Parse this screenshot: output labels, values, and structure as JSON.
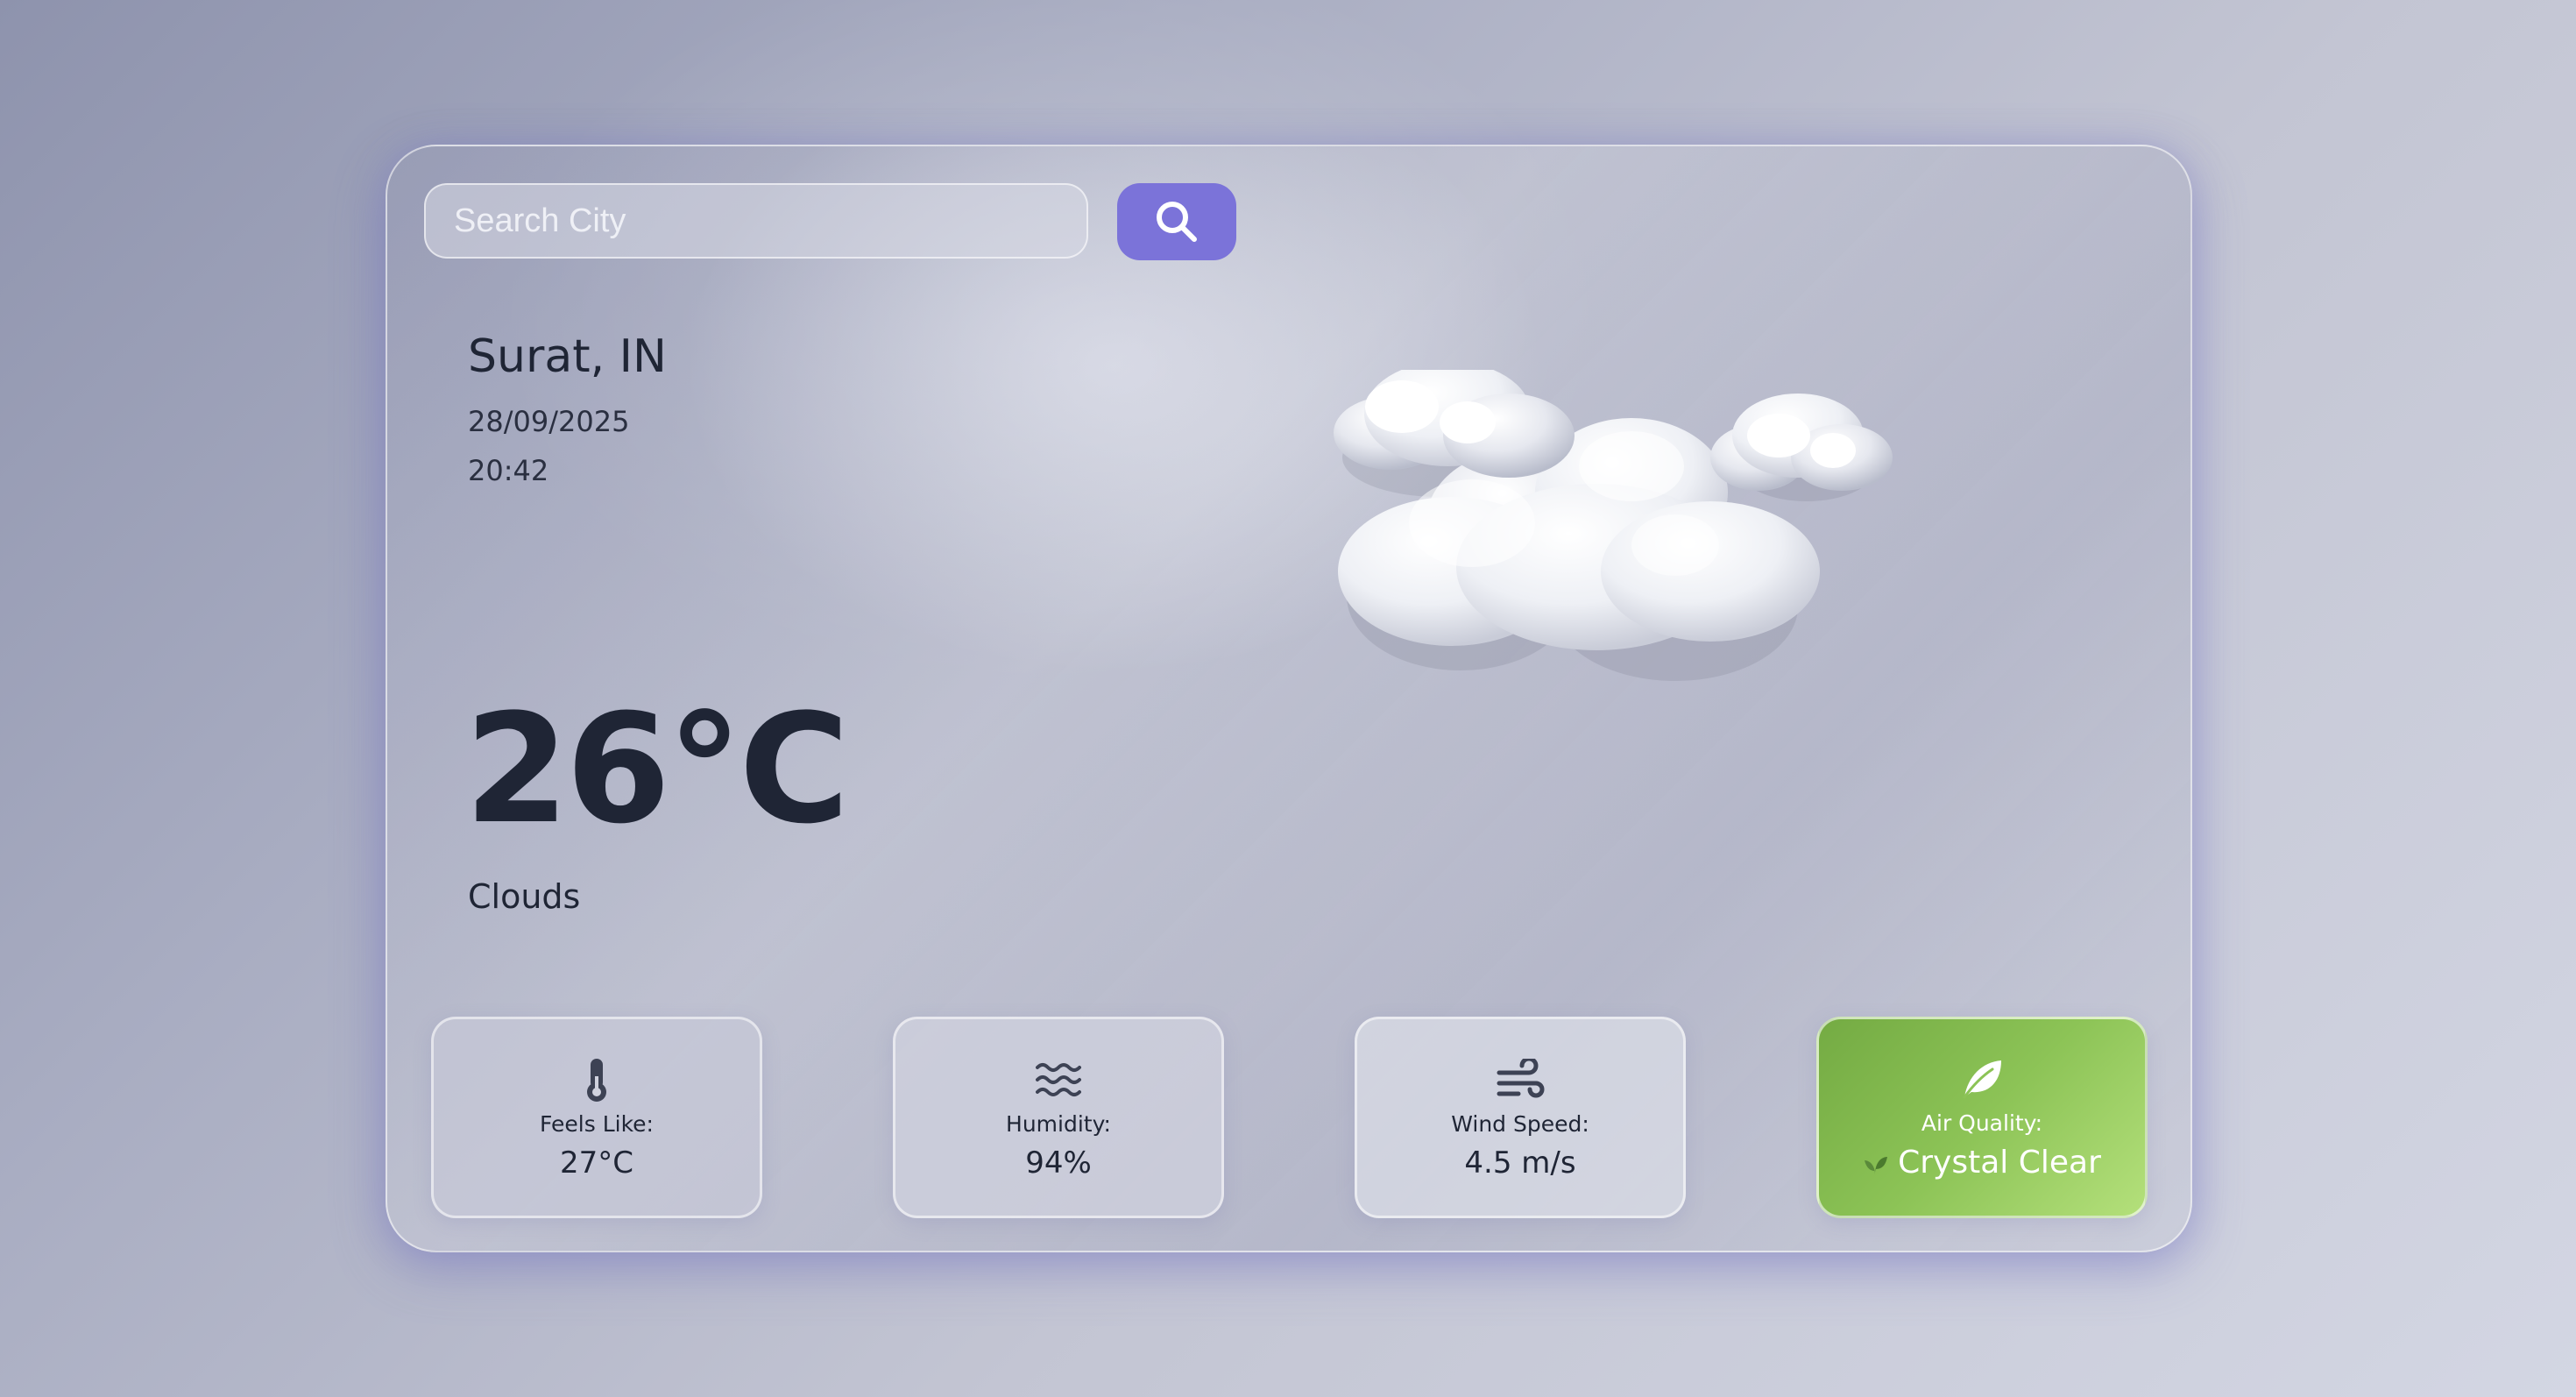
{
  "search": {
    "placeholder": "Search City",
    "icon": "search-icon"
  },
  "location": {
    "name": "Surat, IN",
    "date": "28/09/2025",
    "time": "20:42"
  },
  "weather": {
    "temperature": "26°C",
    "condition": "Clouds",
    "icon": "clouds-icon"
  },
  "stats": {
    "feels_like": {
      "label": "Feels Like:",
      "value": "27°C",
      "icon": "thermometer-icon"
    },
    "humidity": {
      "label": "Humidity:",
      "value": "94%",
      "icon": "water-waves-icon"
    },
    "wind_speed": {
      "label": "Wind Speed:",
      "value": "4.5 m/s",
      "icon": "wind-icon"
    },
    "air_quality": {
      "label": "Air Quality:",
      "value": "Crystal Clear",
      "icon": "leaf-icon"
    }
  },
  "colors": {
    "accent": "#7b73d9",
    "air_quality_good": "#8cc356",
    "text_dark": "#1f2535"
  }
}
